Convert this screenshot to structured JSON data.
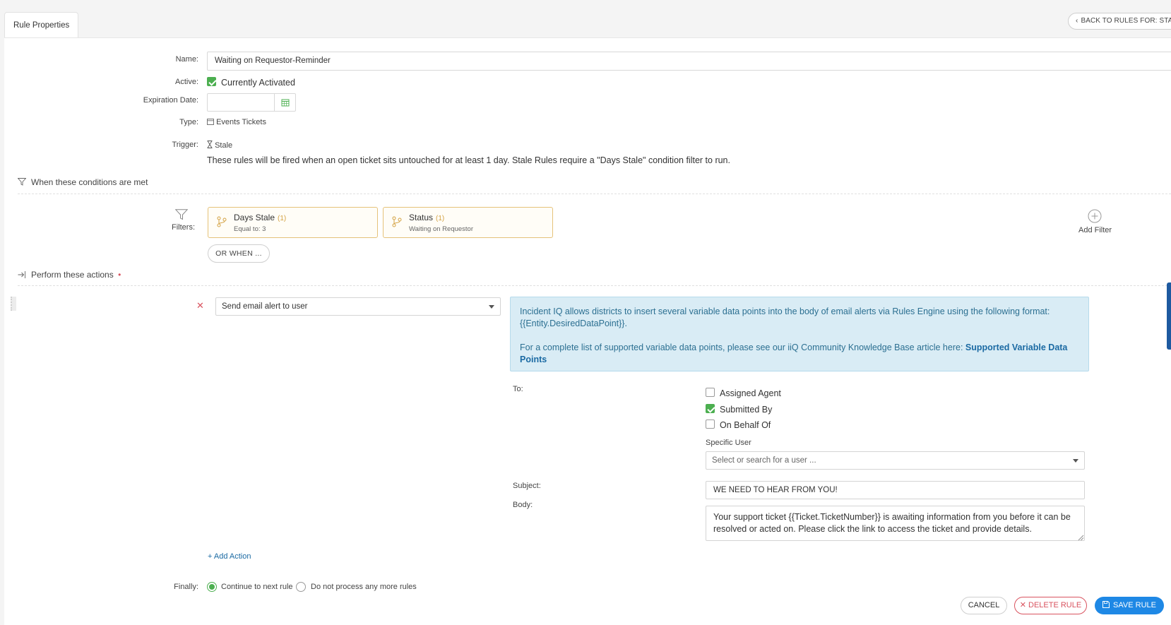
{
  "tab": {
    "label": "Rule Properties"
  },
  "back_button": {
    "label": "BACK TO RULES FOR: STALE"
  },
  "form": {
    "name_label": "Name:",
    "name_value": "Waiting on Requestor-Reminder",
    "active_label": "Active:",
    "active_text": "Currently Activated",
    "active_checked": true,
    "expiration_label": "Expiration Date:",
    "expiration_value": "",
    "type_label": "Type:",
    "type_value": "Events Tickets",
    "trigger_label": "Trigger:",
    "trigger_value": "Stale",
    "trigger_note": "These rules will be fired when an open ticket sits untouched for at least 1 day. Stale Rules require a \"Days Stale\" condition filter to run."
  },
  "conditions": {
    "section_title": "When these conditions are met",
    "filters_label": "Filters:",
    "filters": [
      {
        "title": "Days Stale",
        "count": "(1)",
        "sub": "Equal to: 3"
      },
      {
        "title": "Status",
        "count": "(1)",
        "sub": "Waiting on Requestor"
      }
    ],
    "add_filter_label": "Add Filter",
    "or_when_label": "OR WHEN ..."
  },
  "actions": {
    "section_title": "Perform these actions",
    "required_marker": "•",
    "action_select": "Send email alert to user",
    "info_line1": "Incident IQ allows districts to insert several variable data points into the body of email alerts via Rules Engine using the following format: {{Entity.DesiredDataPoint}}.",
    "info_line2": "For a complete list of supported variable data points, please see our iiQ Community Knowledge Base article here:",
    "info_link": "Supported Variable Data Points",
    "to_label": "To:",
    "recipients": [
      {
        "label": "Assigned Agent",
        "checked": false
      },
      {
        "label": "Submitted By",
        "checked": true
      },
      {
        "label": "On Behalf Of",
        "checked": false
      }
    ],
    "specific_user_label": "Specific User",
    "specific_user_placeholder": "Select or search for a user ...",
    "subject_label": "Subject:",
    "subject_value": "WE NEED TO HEAR FROM YOU!",
    "body_label": "Body:",
    "body_value": "Your support ticket {{Ticket.TicketNumber}} is awaiting information from you before it can be resolved or acted on.  Please click the link to access the ticket and provide details.",
    "add_action_label": "+ Add Action"
  },
  "finally": {
    "label": "Finally:",
    "options": [
      {
        "label": "Continue to next rule",
        "selected": true
      },
      {
        "label": "Do not process any more rules",
        "selected": false
      }
    ]
  },
  "footer": {
    "cancel_label": "CANCEL",
    "delete_label": "DELETE RULE",
    "save_label": "SAVE RULE"
  },
  "colors": {
    "accent_blue": "#1e88e5",
    "success_green": "#4caf50",
    "danger_red": "#d9535f",
    "filter_border": "#e5c27a",
    "info_bg": "#d9ecf5"
  }
}
